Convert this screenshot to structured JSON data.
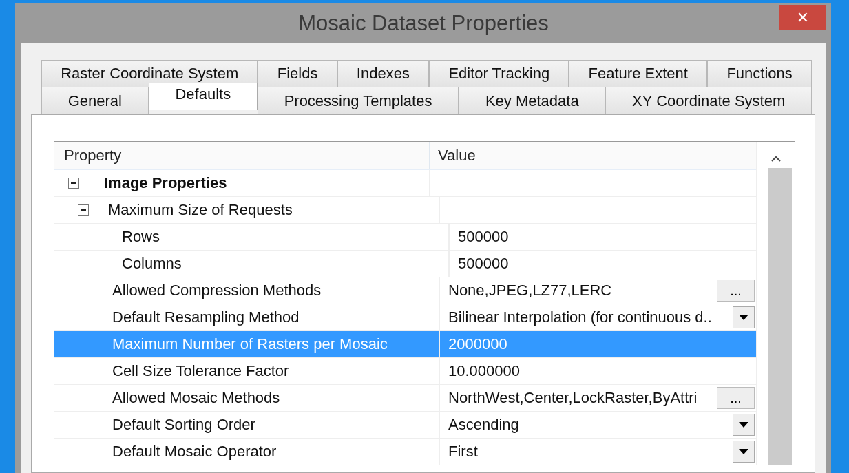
{
  "window": {
    "title": "Mosaic Dataset Properties",
    "close_label": "✕"
  },
  "tab_rows": [
    [
      {
        "label": "Raster Coordinate System",
        "selected": false
      },
      {
        "label": "Fields",
        "selected": false
      },
      {
        "label": "Indexes",
        "selected": false
      },
      {
        "label": "Editor Tracking",
        "selected": false
      },
      {
        "label": "Feature Extent",
        "selected": false
      },
      {
        "label": "Functions",
        "selected": false
      }
    ],
    [
      {
        "label": "General",
        "selected": false
      },
      {
        "label": "Defaults",
        "selected": true
      },
      {
        "label": "Processing Templates",
        "selected": false
      },
      {
        "label": "Key Metadata",
        "selected": false
      },
      {
        "label": "XY Coordinate System",
        "selected": false
      }
    ]
  ],
  "grid": {
    "columns": [
      "Property",
      "Value"
    ],
    "rows": [
      {
        "name": "Image Properties",
        "kind": "group",
        "expanded": true,
        "selected": false,
        "children": [
          {
            "name": "Maximum Size of Requests",
            "kind": "group",
            "expanded": true,
            "selected": false,
            "children": [
              {
                "name": "Rows",
                "kind": "text",
                "value": "500000",
                "selected": false
              },
              {
                "name": "Columns",
                "kind": "text",
                "value": "500000",
                "selected": false
              }
            ]
          },
          {
            "name": "Allowed Compression Methods",
            "kind": "ellipsis",
            "value": "None,JPEG,LZ77,LERC",
            "button_label": "...",
            "selected": false
          },
          {
            "name": "Default Resampling Method",
            "kind": "dropdown",
            "value": "Bilinear Interpolation (for continuous d..",
            "selected": false
          },
          {
            "name": "Maximum Number of Rasters per Mosaic",
            "kind": "text",
            "value": "2000000",
            "selected": true
          },
          {
            "name": "Cell Size Tolerance Factor",
            "kind": "text",
            "value": "10.000000",
            "selected": false
          },
          {
            "name": "Allowed Mosaic Methods",
            "kind": "ellipsis",
            "value": "NorthWest,Center,LockRaster,ByAttri",
            "button_label": "...",
            "selected": false
          },
          {
            "name": "Default Sorting Order",
            "kind": "dropdown",
            "value": "Ascending",
            "selected": false
          },
          {
            "name": "Default Mosaic Operator",
            "kind": "dropdown",
            "value": "First",
            "selected": false
          }
        ]
      }
    ]
  }
}
